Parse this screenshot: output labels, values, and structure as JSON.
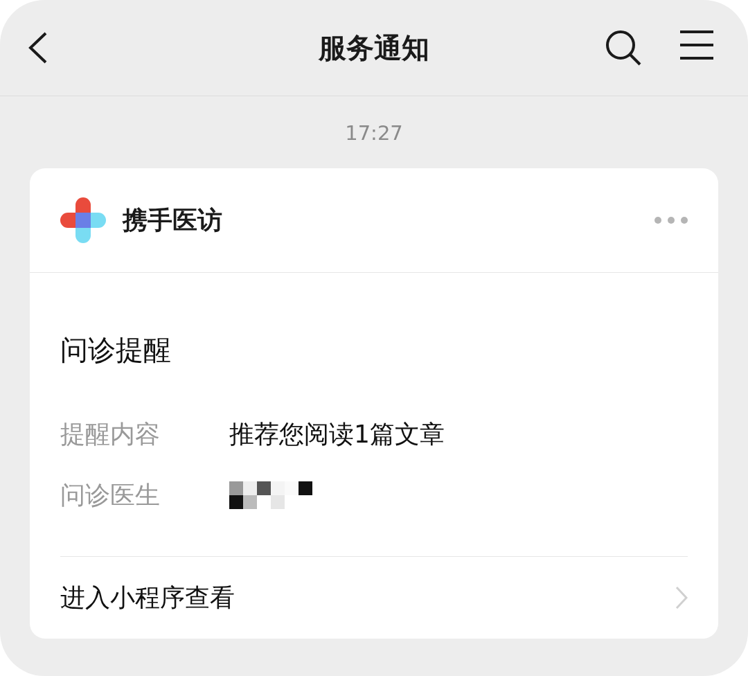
{
  "header": {
    "title": "服务通知"
  },
  "time": "17:27",
  "card": {
    "app_name": "携手医访",
    "title": "问诊提醒",
    "fields": [
      {
        "label": "提醒内容",
        "kind": "text",
        "value": "推荐您阅读1篇文章"
      },
      {
        "label": "问诊医生",
        "kind": "mosaic"
      }
    ],
    "action": "进入小程序查看"
  }
}
